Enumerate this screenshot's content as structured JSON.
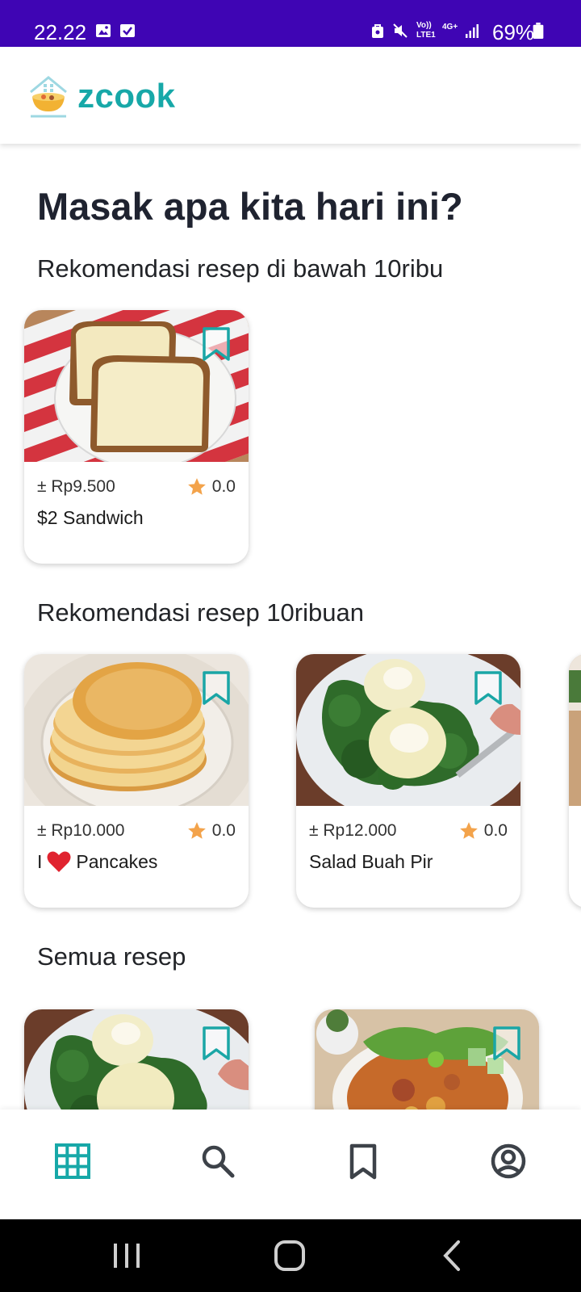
{
  "status_bar": {
    "time": "22.22",
    "battery": "69%",
    "network_label_1": "Vo)) LTE1",
    "network_label_2": "4G+"
  },
  "header": {
    "app_name": "zcook",
    "logo_icon": "cooking-pot-house-icon"
  },
  "page": {
    "title": "Masak apa kita hari ini?"
  },
  "sections": [
    {
      "title": "Rekomendasi resep di bawah 10ribu",
      "cards": [
        {
          "price": "± Rp9.500",
          "rating": "0.0",
          "title": "$2 Sandwich",
          "image": "buttered-toast-photo"
        }
      ]
    },
    {
      "title": "Rekomendasi resep 10ribuan",
      "cards": [
        {
          "price": "± Rp10.000",
          "rating": "0.0",
          "title_prefix": "I",
          "title_emoji": "red-heart",
          "title": "Pancakes",
          "image": "pancake-stack-photo"
        },
        {
          "price": "± Rp12.000",
          "rating": "0.0",
          "title": "Salad Buah Pir",
          "image": "pear-salad-photo"
        }
      ]
    },
    {
      "title": "Semua resep",
      "cards": [
        {
          "image": "pear-salad-photo"
        },
        {
          "image": "fried-rice-salad-photo"
        }
      ]
    }
  ],
  "bottom_nav": {
    "items": [
      {
        "icon": "grid-icon",
        "active": true
      },
      {
        "icon": "search-icon",
        "active": false
      },
      {
        "icon": "bookmark-icon",
        "active": false
      },
      {
        "icon": "account-icon",
        "active": false
      }
    ]
  },
  "colors": {
    "status_bar": "#3f05b4",
    "brand_teal": "#17a8a8",
    "star": "#f3a34b",
    "heart": "#e0232f"
  }
}
